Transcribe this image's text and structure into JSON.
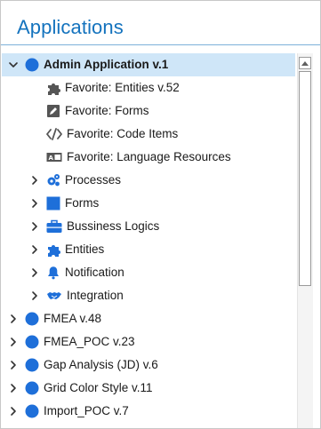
{
  "panel": {
    "title": "Applications"
  },
  "tree": [
    {
      "label": "Admin Application v.1",
      "caret": "down",
      "icon": "circle-app",
      "bold": true,
      "selected": true,
      "level": 0
    },
    {
      "label": "Favorite: Entities v.52",
      "caret": "none",
      "icon": "puzzle-gray",
      "level": 2
    },
    {
      "label": "Favorite: Forms",
      "caret": "none",
      "icon": "edit-box",
      "level": 2
    },
    {
      "label": "Favorite: Code Items",
      "caret": "none",
      "icon": "code",
      "level": 2
    },
    {
      "label": "Favorite: Language Resources",
      "caret": "none",
      "icon": "language-box",
      "level": 2
    },
    {
      "label": "Processes",
      "caret": "right",
      "icon": "gears",
      "level": 1
    },
    {
      "label": "Forms",
      "caret": "right",
      "icon": "square-blue",
      "level": 1
    },
    {
      "label": "Bussiness Logics",
      "caret": "right",
      "icon": "briefcase",
      "level": 1
    },
    {
      "label": "Entities",
      "caret": "right",
      "icon": "puzzle-blue",
      "level": 1
    },
    {
      "label": "Notification",
      "caret": "right",
      "icon": "bell",
      "level": 1
    },
    {
      "label": "Integration",
      "caret": "right",
      "icon": "handshake",
      "level": 1
    },
    {
      "label": "FMEA v.48",
      "caret": "right",
      "icon": "circle-app",
      "level": 0
    },
    {
      "label": "FMEA_POC v.23",
      "caret": "right",
      "icon": "circle-app",
      "level": 0
    },
    {
      "label": "Gap Analysis (JD) v.6",
      "caret": "right",
      "icon": "circle-app",
      "level": 0
    },
    {
      "label": "Grid Color Style v.11",
      "caret": "right",
      "icon": "circle-app",
      "level": 0
    },
    {
      "label": "Import_POC v.7",
      "caret": "right",
      "icon": "circle-app",
      "level": 0
    }
  ],
  "colors": {
    "accent": "#1473be",
    "app_icon": "#1e6fd9",
    "selected_row": "#cfe6f8",
    "gray_icon": "#555555"
  }
}
